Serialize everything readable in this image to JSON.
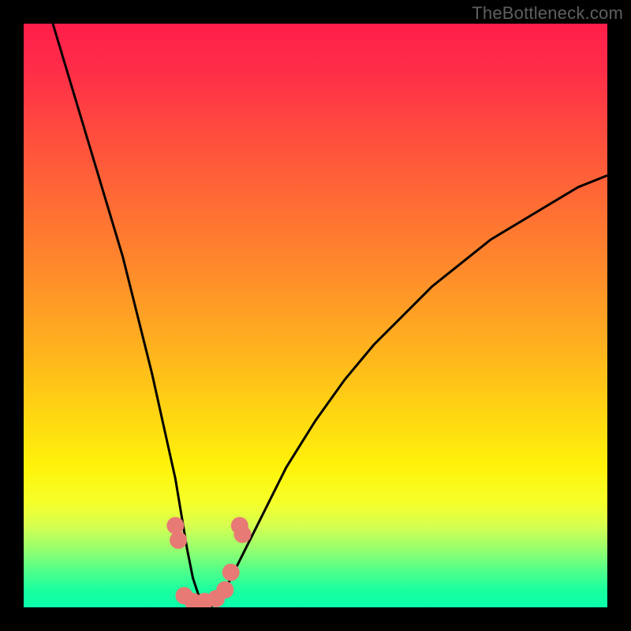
{
  "watermark": {
    "text": "TheBottleneck.com"
  },
  "chart_data": {
    "type": "line",
    "title": "",
    "xlabel": "",
    "ylabel": "",
    "xlim": [
      0,
      100
    ],
    "ylim": [
      0,
      100
    ],
    "series": [
      {
        "name": "bottleneck-curve",
        "x": [
          5,
          8,
          11,
          14,
          17,
          20,
          22,
          24,
          26,
          27,
          28,
          29,
          30,
          31,
          32,
          34,
          36,
          40,
          45,
          50,
          55,
          60,
          65,
          70,
          75,
          80,
          85,
          90,
          95,
          100
        ],
        "y": [
          100,
          90,
          80,
          70,
          60,
          48,
          40,
          31,
          22,
          16,
          10,
          5,
          2,
          0,
          0,
          2,
          6,
          14,
          24,
          32,
          39,
          45,
          50,
          55,
          59,
          63,
          66,
          69,
          72,
          74
        ]
      }
    ],
    "markers": [
      {
        "name": "marker-left-1",
        "x": 26.0,
        "y": 14.0
      },
      {
        "name": "marker-left-2",
        "x": 26.5,
        "y": 11.5
      },
      {
        "name": "marker-low-1",
        "x": 27.5,
        "y": 2.0
      },
      {
        "name": "marker-low-2",
        "x": 29.0,
        "y": 1.0
      },
      {
        "name": "marker-low-3",
        "x": 31.0,
        "y": 1.0
      },
      {
        "name": "marker-low-4",
        "x": 33.0,
        "y": 1.5
      },
      {
        "name": "marker-low-5",
        "x": 34.5,
        "y": 3.0
      },
      {
        "name": "marker-low-6",
        "x": 35.5,
        "y": 6.0
      },
      {
        "name": "marker-right-1",
        "x": 37.0,
        "y": 14.0
      },
      {
        "name": "marker-right-2",
        "x": 37.5,
        "y": 12.5
      }
    ],
    "colors": {
      "curve": "#000000",
      "marker": "#e77a75",
      "gradient_top": "#ff1e4b",
      "gradient_bottom": "#0affab"
    }
  }
}
